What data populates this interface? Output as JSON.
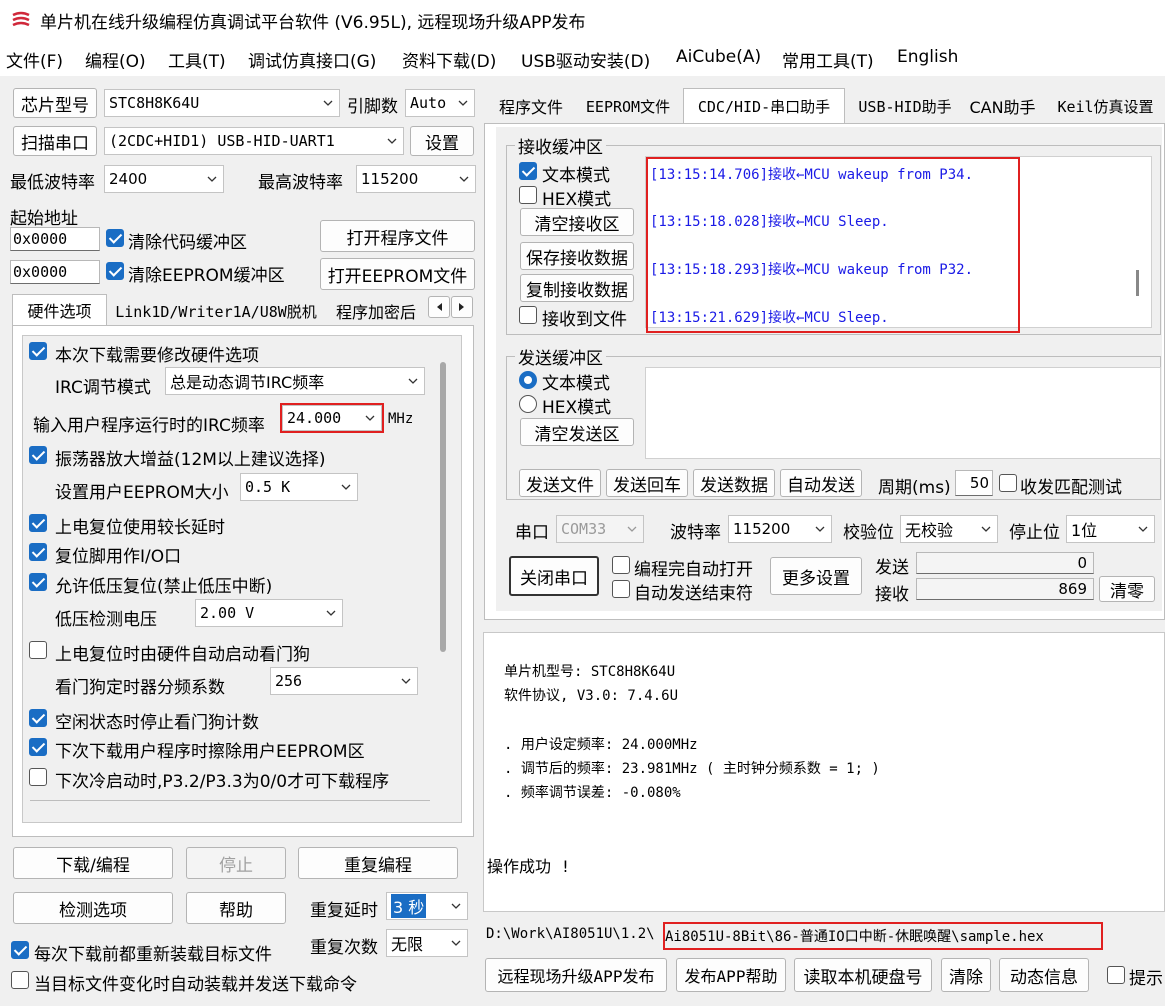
{
  "window": {
    "title": "单片机在线升级编程仿真调试平台软件 (V6.95L), 远程现场升级APP发布"
  },
  "menu": [
    "文件(F)",
    "编程(O)",
    "工具(T)",
    "调试仿真接口(G)",
    "资料下载(D)",
    "USB驱动安装(D)",
    "AiCube(A)",
    "常用工具(T)",
    "English"
  ],
  "left": {
    "chip_btn": "芯片型号",
    "chip_value": "STC8H8K64U",
    "pin_label": "引脚数",
    "pin_value": "Auto",
    "scan_btn": "扫描串口",
    "port_value": "(2CDC+HID1) USB-HID-UART1",
    "settings_btn": "设置",
    "min_baud_label": "最低波特率",
    "min_baud": "2400",
    "max_baud_label": "最高波特率",
    "max_baud": "115200",
    "start_addr_label": "起始地址",
    "addr1": "0x0000",
    "clear_code": "清除代码缓冲区",
    "open_prog": "打开程序文件",
    "addr2": "0x0000",
    "clear_eeprom": "清除EEPROM缓冲区",
    "open_eeprom": "打开EEPROM文件",
    "tabs": [
      "硬件选项",
      "Link1D/Writer1A/U8W脱机",
      "程序加密后"
    ],
    "hw": {
      "modify_hw": "本次下载需要修改硬件选项",
      "irc_mode_label": "IRC调节模式",
      "irc_mode_value": "总是动态调节IRC频率",
      "irc_freq_label": "输入用户程序运行时的IRC频率",
      "irc_freq_value": "24.000",
      "irc_freq_unit": "MHz",
      "osc_gain": "振荡器放大增益(12M以上建议选择)",
      "eeprom_size_label": "设置用户EEPROM大小",
      "eeprom_size_value": "0.5 K",
      "long_delay": "上电复位使用较长延时",
      "reset_io": "复位脚用作I/O口",
      "lvr": "允许低压复位(禁止低压中断)",
      "lvd_label": "低压检测电压",
      "lvd_value": "2.00 V",
      "wdt_auto": "上电复位时由硬件自动启动看门狗",
      "wdt_div_label": "看门狗定时器分频系数",
      "wdt_div_value": "256",
      "idle_wdt": "空闲状态时停止看门狗计数",
      "erase_eeprom": "下次下载用户程序时擦除用户EEPROM区",
      "cold_boot": "下次冷启动时,P3.2/P3.3为0/0才可下载程序"
    },
    "download_btn": "下载/编程",
    "stop_btn": "停止",
    "reprog_btn": "重复编程",
    "check_btn": "检测选项",
    "help_btn": "帮助",
    "repeat_delay_label": "重复延时",
    "repeat_delay_value": "3 秒",
    "repeat_count_label": "重复次数",
    "repeat_count_value": "无限",
    "reload_each": "每次下载前都重新装载目标文件",
    "auto_reload": "当目标文件变化时自动装载并发送下载命令"
  },
  "right": {
    "tabs": [
      "程序文件",
      "EEPROM文件",
      "CDC/HID-串口助手",
      "USB-HID助手",
      "CAN助手",
      "Keil仿真设置"
    ],
    "rx": {
      "title": "接收缓冲区",
      "text_mode": "文本模式",
      "hex_mode": "HEX模式",
      "clear_btn": "清空接收区",
      "save_btn": "保存接收数据",
      "copy_btn": "复制接收数据",
      "to_file": "接收到文件",
      "lines": [
        "[13:15:14.706]接收←MCU wakeup from P34.",
        "[13:15:18.028]接收←MCU Sleep.",
        "[13:15:18.293]接收←MCU wakeup from P32.",
        "[13:15:21.629]接收←MCU Sleep."
      ]
    },
    "tx": {
      "title": "发送缓冲区",
      "text_mode": "文本模式",
      "hex_mode": "HEX模式",
      "clear_btn": "清空发送区",
      "send_file": "发送文件",
      "send_cr": "发送回车",
      "send_data": "发送数据",
      "auto_send": "自动发送",
      "period_label": "周期(ms)",
      "period_value": "50",
      "match_test": "收发匹配测试"
    },
    "port": {
      "port_label": "串口",
      "port_value": "COM33",
      "baud_label": "波特率",
      "baud_value": "115200",
      "parity_label": "校验位",
      "parity_value": "无校验",
      "stop_label": "停止位",
      "stop_value": "1位",
      "close_btn": "关闭串口",
      "auto_open": "编程完自动打开",
      "auto_send_end": "自动发送结束符",
      "more_btn": "更多设置",
      "send_label": "发送",
      "send_count": "0",
      "recv_label": "接收",
      "recv_count": "869",
      "clear_btn": "清零"
    },
    "log": {
      "lines": [
        "单片机型号: STC8H8K64U",
        "软件协议, V3.0: 7.4.6U",
        ". 用户设定频率: 24.000MHz",
        ". 调节后的频率: 23.981MHz ( 主时钟分频系数 = 1; )",
        ". 频率调节误差: -0.080%",
        "操作成功 !"
      ]
    },
    "path_prefix": "D:\\Work\\AI8051U\\1.2\\",
    "path_highlight": "Ai8051U-8Bit\\86-普通IO口中断-休眠唤醒\\sample.hex",
    "bottom": [
      "远程现场升级APP发布",
      "发布APP帮助",
      "读取本机硬盘号",
      "清除",
      "动态信息",
      "提示"
    ]
  },
  "colors": {
    "accent": "#1a6dc4",
    "highlight": "#e02020",
    "rx_text": "#1a1ae6"
  }
}
